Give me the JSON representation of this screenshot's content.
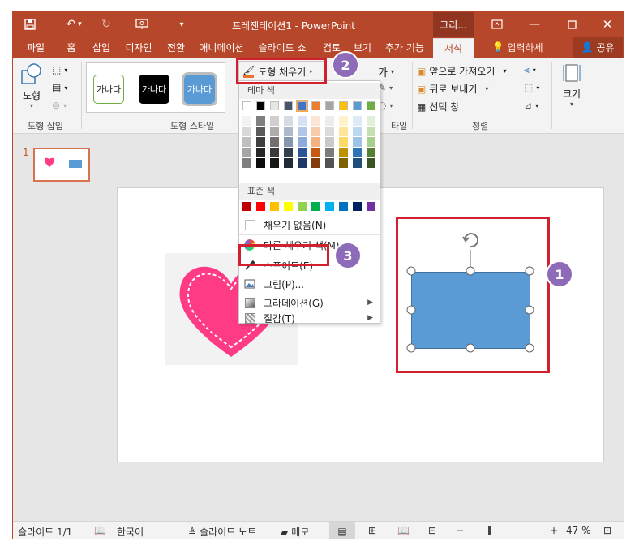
{
  "window": {
    "title": "프레젠테이션1 - PowerPoint",
    "context_title": "그리...",
    "qat": {
      "save": "save-icon",
      "undo": "undo-icon",
      "redo": "redo-icon",
      "present": "present-icon",
      "customize": "customize-icon"
    }
  },
  "tabs": [
    {
      "label": "파일"
    },
    {
      "label": "홈"
    },
    {
      "label": "삽입"
    },
    {
      "label": "디자인"
    },
    {
      "label": "전환"
    },
    {
      "label": "애니메이션"
    },
    {
      "label": "슬라이드 쇼"
    },
    {
      "label": "검토"
    },
    {
      "label": "보기"
    },
    {
      "label": "추가 기능"
    },
    {
      "label": "서식"
    }
  ],
  "tell_me": "입력하세",
  "share": "공유",
  "ribbon": {
    "insert_shapes": {
      "shape_label": "도형",
      "group_label": "도형 삽입"
    },
    "shape_styles": {
      "style_text": "가나다",
      "group_label": "도형 스타일"
    },
    "fill_button": "도형 채우기",
    "text_a_label": "가",
    "wordart_group_label": "타일",
    "arrange": {
      "bring_forward": "앞으로 가져오기",
      "send_backward": "뒤로 보내기",
      "selection_pane": "선택 창",
      "group_label": "정렬"
    },
    "size": {
      "label": "크기"
    }
  },
  "dropdown": {
    "theme_colors_header": "테마 색",
    "standard_colors_header": "표준 색",
    "no_fill": "채우기 없음(N)",
    "more_colors": "다른 채우기 색(M)...",
    "eyedropper": "스포이트(E)",
    "picture": "그림(P)...",
    "gradient": "그라데이션(G)",
    "texture": "질감(T)",
    "theme_row": [
      "#ffffff",
      "#000000",
      "#e7e6e6",
      "#44546a",
      "#4472c4",
      "#ed7d31",
      "#a5a5a5",
      "#ffc000",
      "#5b9bd5",
      "#70ad47"
    ],
    "theme_shades": [
      [
        "#f2f2f2",
        "#808080",
        "#d0cece",
        "#d6dce4",
        "#d9e2f3",
        "#fbe5d5",
        "#ededed",
        "#fff2cc",
        "#deebf6",
        "#e2efd9"
      ],
      [
        "#d8d8d8",
        "#595959",
        "#aeabab",
        "#adb9ca",
        "#b4c6e7",
        "#f7cbac",
        "#dbdbdb",
        "#fee599",
        "#bdd7ee",
        "#c5e0b3"
      ],
      [
        "#bfbfbf",
        "#3f3f3f",
        "#757070",
        "#8496b0",
        "#8eaadb",
        "#f4b183",
        "#c9c9c9",
        "#ffd965",
        "#9dc3e6",
        "#a8d08d"
      ],
      [
        "#a5a5a5",
        "#262626",
        "#3a3838",
        "#323f4f",
        "#2f5496",
        "#c55a11",
        "#7b7b7b",
        "#bf9000",
        "#2e75b5",
        "#538135"
      ],
      [
        "#7f7f7f",
        "#0c0c0c",
        "#171616",
        "#222a35",
        "#1f3864",
        "#833c0b",
        "#525252",
        "#7f6000",
        "#1e4e79",
        "#375623"
      ]
    ],
    "standard_row": [
      "#c00000",
      "#ff0000",
      "#ffc000",
      "#ffff00",
      "#92d050",
      "#00b050",
      "#00b0f0",
      "#0070c0",
      "#002060",
      "#7030a0"
    ]
  },
  "slide_panel": {
    "number": "1"
  },
  "shapes": {
    "rect_color": "#5b9bd5",
    "heart_color": "#ff3b86"
  },
  "callouts": {
    "one": "1",
    "two": "2",
    "three": "3"
  },
  "status": {
    "slide": "슬라이드 1/1",
    "language": "한국어",
    "notes": "슬라이드 노트",
    "comments": "메모",
    "zoom": "47 %"
  }
}
